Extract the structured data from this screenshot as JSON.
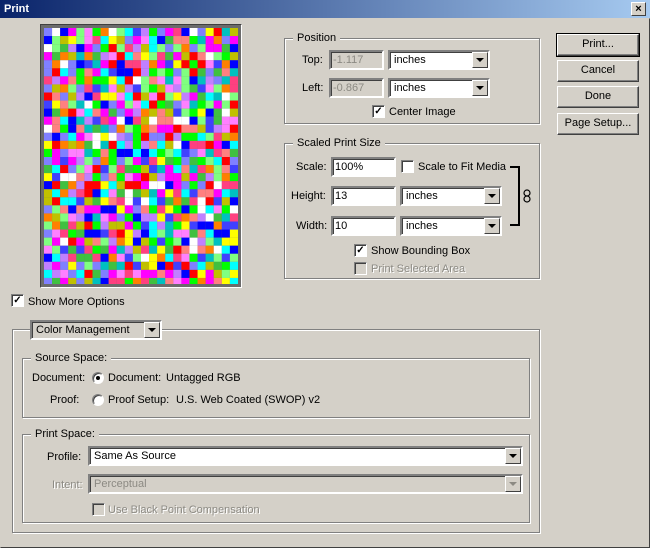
{
  "window": {
    "title": "Print",
    "close_glyph": "×"
  },
  "buttons": {
    "print": "Print...",
    "cancel": "Cancel",
    "done": "Done",
    "page_setup": "Page Setup..."
  },
  "position": {
    "title": "Position",
    "top_label": "Top:",
    "top_value": "-1.117",
    "top_unit": "inches",
    "left_label": "Left:",
    "left_value": "-0.867",
    "left_unit": "inches",
    "center_image_label": "Center Image",
    "center_image_checked": true
  },
  "scaled": {
    "title": "Scaled Print Size",
    "scale_label": "Scale:",
    "scale_value": "100%",
    "scale_to_fit_label": "Scale to Fit Media",
    "scale_to_fit_checked": false,
    "height_label": "Height:",
    "height_value": "13",
    "height_unit": "inches",
    "width_label": "Width:",
    "width_value": "10",
    "width_unit": "inches",
    "show_bounding_label": "Show Bounding Box",
    "show_bounding_checked": true,
    "print_selected_label": "Print Selected Area",
    "print_selected_checked": false,
    "link_icon": "chain-link-icon"
  },
  "show_more_options": {
    "label": "Show More Options",
    "checked": true
  },
  "options_mode": "Color Management",
  "source_space": {
    "title": "Source Space:",
    "document_label": "Document:",
    "document_option": "Document:",
    "document_value": "Untagged RGB",
    "document_selected": true,
    "proof_label": "Proof:",
    "proof_option": "Proof Setup:",
    "proof_value": "U.S. Web Coated (SWOP) v2",
    "proof_selected": false
  },
  "print_space": {
    "title": "Print Space:",
    "profile_label": "Profile:",
    "profile_value": "Same As Source",
    "intent_label": "Intent:",
    "intent_value": "Perceptual",
    "bpc_label": "Use Black Point Compensation",
    "bpc_checked": false
  },
  "check_glyph": "✓",
  "colors": {
    "titlebar_start": "#0a246a",
    "titlebar_end": "#a6caf0",
    "dialog_bg": "#d4d0c8"
  },
  "preview": {
    "palette": [
      "#ff0000",
      "#00ff00",
      "#0000ff",
      "#ffff00",
      "#ff00ff",
      "#00ffff",
      "#ff8080",
      "#80ff80",
      "#8080ff",
      "#ff80ff",
      "#ffffff",
      "#c080ff",
      "#ff4080",
      "#40c040",
      "#4040ff",
      "#ff8000",
      "#00c0c0",
      "#c0c000"
    ]
  }
}
